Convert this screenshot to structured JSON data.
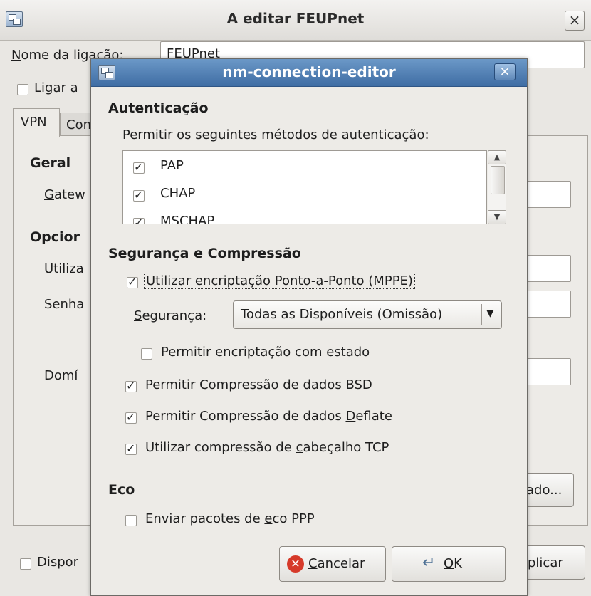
{
  "background_window": {
    "title": "A editar FEUPnet",
    "close_glyph": "×",
    "connection_name_label_prefix": "N",
    "connection_name_label_rest": "ome da ligação:",
    "connection_name_value": "FEUPnet",
    "connect_auto_label_prefix": "Ligar ",
    "connect_auto_label_underline": "a",
    "tab_vpn": "VPN",
    "tab_con": "Con",
    "geral_heading": "Geral",
    "gateway_prefix": "G",
    "gateway_rest": "atew",
    "options_heading": "Opcior",
    "user_label": "Utiliza",
    "password_label": "Senha",
    "domain_label": "Domí",
    "advanced_button_fragment": "ado...",
    "available_label": "Dispor",
    "apply_button_fragment": "plicar"
  },
  "dialog": {
    "title": "nm-connection-editor",
    "close_glyph": "×",
    "authentication": {
      "heading": "Autenticação",
      "description": "Permitir os seguintes métodos de autenticação:",
      "methods": [
        {
          "label": "PAP",
          "checked": true
        },
        {
          "label": "CHAP",
          "checked": true
        },
        {
          "label": "MSCHAP",
          "checked": true
        }
      ]
    },
    "security": {
      "heading": "Segurança e Compressão",
      "mppe_pre": "Utilizar encriptação ",
      "mppe_underline": "P",
      "mppe_post": "onto-a-Ponto (MPPE)",
      "mppe_checked": true,
      "security_label_underline": "S",
      "security_label_rest": "egurança:",
      "security_value": "Todas as Disponíveis (Omissão)",
      "stateful_pre": "Permitir encriptação com est",
      "stateful_underline": "a",
      "stateful_post": "do",
      "stateful_checked": false,
      "bsd_pre": "Permitir Compressão de dados ",
      "bsd_underline": "B",
      "bsd_post": "SD",
      "bsd_checked": true,
      "deflate_pre": "Permitir Compressão de dados ",
      "deflate_underline": "D",
      "deflate_post": "eflate",
      "deflate_checked": true,
      "tcp_pre": "Utilizar compressão de ",
      "tcp_underline": "c",
      "tcp_post": "abeçalho TCP",
      "tcp_checked": true
    },
    "echo": {
      "heading": "Eco",
      "send_pre": "Enviar pacotes de ",
      "send_underline": "e",
      "send_post": "co PPP",
      "send_checked": false
    },
    "buttons": {
      "cancel_underline": "C",
      "cancel_rest": "ancelar",
      "ok_underline": "O",
      "ok_rest": "K"
    }
  },
  "colors": {
    "titlebar_blue": "#4a78ad",
    "window_bg": "#edebe7",
    "cancel_icon_red": "#d63a2a"
  }
}
